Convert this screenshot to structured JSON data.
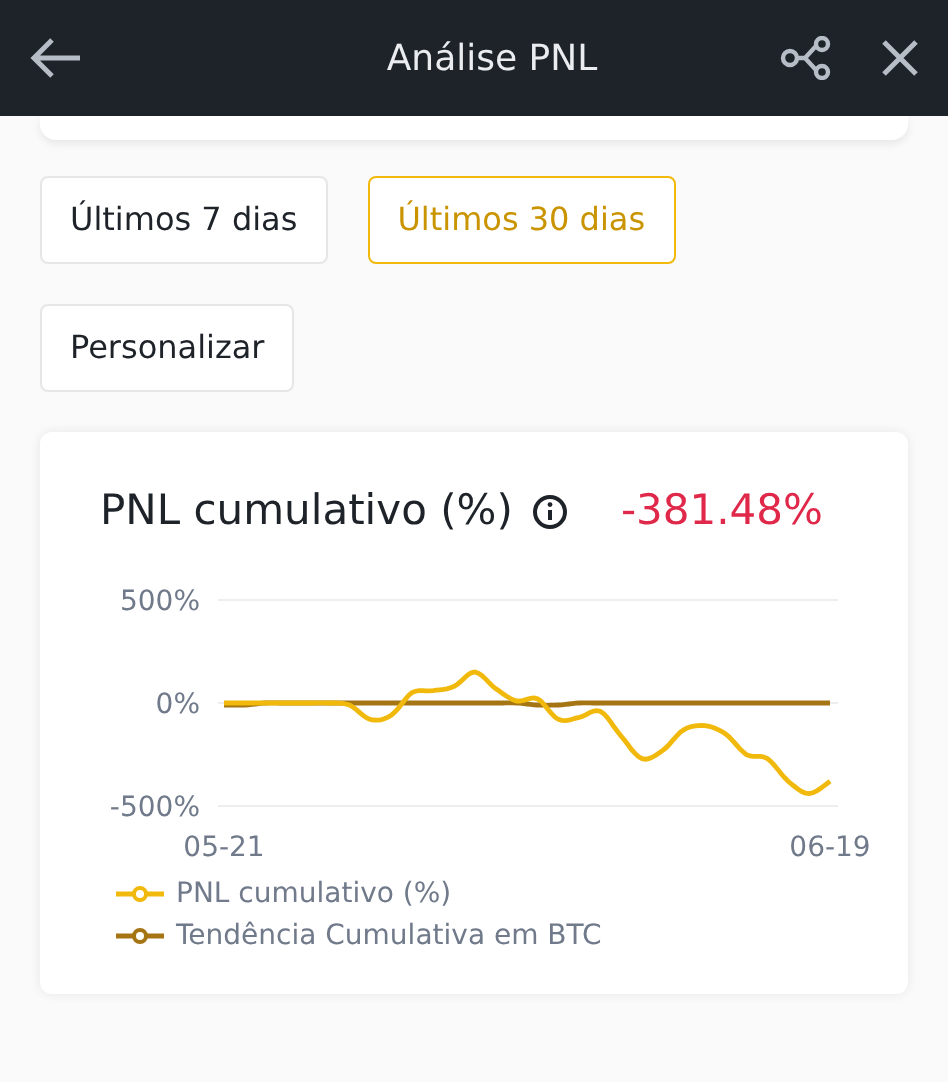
{
  "header": {
    "title": "Análise PNL"
  },
  "ranges": [
    {
      "label": "Últimos 7 dias",
      "selected": false
    },
    {
      "label": "Últimos 30 dias",
      "selected": true
    },
    {
      "label": "Personalizar",
      "selected": false
    }
  ],
  "pnl_card": {
    "title": "PNL cumulativo (%)",
    "value": "-381.48%",
    "chart_data": {
      "type": "line",
      "categories": [
        "05-21",
        null,
        null,
        null,
        null,
        null,
        null,
        null,
        null,
        null,
        null,
        null,
        null,
        null,
        null,
        null,
        null,
        null,
        null,
        null,
        null,
        null,
        null,
        null,
        null,
        null,
        null,
        null,
        null,
        "06-19"
      ],
      "ylim": [
        -500,
        500
      ],
      "yticks": [
        {
          "value": 500,
          "label": "500%"
        },
        {
          "value": 0,
          "label": "0%"
        },
        {
          "value": -500,
          "label": "-500%"
        }
      ],
      "series": [
        {
          "name": "PNL cumulativo (%)",
          "color": "#f0b90b",
          "values": [
            0,
            0,
            0,
            0,
            0,
            0,
            -10,
            -80,
            -60,
            50,
            60,
            80,
            150,
            70,
            10,
            20,
            -80,
            -70,
            -40,
            -160,
            -270,
            -230,
            -130,
            -110,
            -150,
            -250,
            -270,
            -380,
            -440,
            -380
          ]
        },
        {
          "name": "Tendência Cumulativa em BTC",
          "color": "#a57413",
          "values": [
            -10,
            -10,
            0,
            0,
            0,
            0,
            0,
            0,
            0,
            0,
            0,
            0,
            0,
            0,
            0,
            -10,
            -10,
            0,
            0,
            0,
            0,
            0,
            0,
            0,
            0,
            0,
            0,
            0,
            0,
            0
          ]
        }
      ]
    }
  }
}
